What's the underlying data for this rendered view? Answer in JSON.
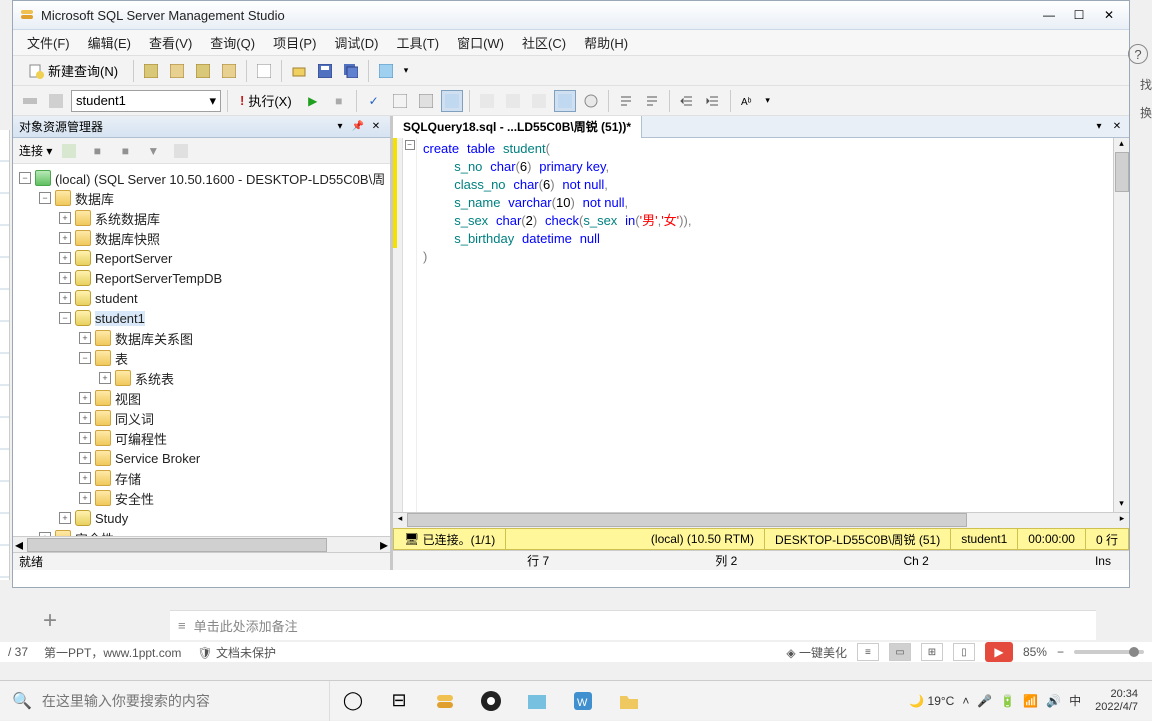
{
  "window": {
    "title": "Microsoft SQL Server Management Studio"
  },
  "menubar": [
    "文件(F)",
    "编辑(E)",
    "查看(V)",
    "查询(Q)",
    "项目(P)",
    "调试(D)",
    "工具(T)",
    "窗口(W)",
    "社区(C)",
    "帮助(H)"
  ],
  "toolbar1": {
    "newquery": "新建查询(N)"
  },
  "toolbar2": {
    "database": "student1",
    "execute": "执行(X)"
  },
  "objectExplorer": {
    "title": "对象资源管理器",
    "connect": "连接 ▾",
    "server": "(local) (SQL Server 10.50.1600 - DESKTOP-LD55C0B\\周",
    "nodes": {
      "databases": "数据库",
      "sysdb": "系统数据库",
      "snapshot": "数据库快照",
      "report": "ReportServer",
      "reportTemp": "ReportServerTempDB",
      "student": "student",
      "student1": "student1",
      "diagram": "数据库关系图",
      "tables": "表",
      "systables": "系统表",
      "views": "视图",
      "synonyms": "同义词",
      "programmability": "可编程性",
      "servicebroker": "Service Broker",
      "storage": "存储",
      "security1": "安全性",
      "study": "Study",
      "security2": "安全性"
    },
    "status": "就绪"
  },
  "editor": {
    "tab": "SQLQuery18.sql - ...LD55C0B\\周锐 (51))*",
    "code": {
      "l1_create": "create",
      "l1_table": "table",
      "l1_name": "student",
      "l1_p": "(",
      "l2_col": "s_no",
      "l2_type": "char",
      "l2_p": "(",
      "l2_n": "6",
      "l2_pc": ")",
      "l2_pk": "primary key",
      "l2_c": ",",
      "l3_col": "class_no",
      "l3_type": "char",
      "l3_p": "(",
      "l3_n": "6",
      "l3_pc": ")",
      "l3_nn": "not null",
      "l3_c": ",",
      "l4_col": "s_name",
      "l4_type": "varchar",
      "l4_p": "(",
      "l4_n": "10",
      "l4_pc": ")",
      "l4_nn": "not null",
      "l4_c": ",",
      "l5_col": "s_sex",
      "l5_type": "char",
      "l5_p": "(",
      "l5_n": "2",
      "l5_pc": ")",
      "l5_check": "check",
      "l5_po": "(",
      "l5_cid": "s_sex",
      "l5_in": "in",
      "l5_po2": "(",
      "l5_s1": "'男'",
      "l5_cm": ",",
      "l5_s2": "'女'",
      "l5_pc2": "))",
      "l5_c": ",",
      "l6_col": "s_birthday",
      "l6_type": "datetime",
      "l6_null": "null",
      "l7_p": ")"
    },
    "statusRow": {
      "row": "行 7",
      "col": "列 2",
      "ch": "Ch 2",
      "ins": "Ins"
    }
  },
  "connStatus": {
    "icon": "🖥",
    "connected": "已连接。(1/1)",
    "server": "(local) (10.50 RTM)",
    "login": "DESKTOP-LD55C0B\\周锐 (51)",
    "db": "student1",
    "time": "00:00:00",
    "rows": "0 行"
  },
  "ppt": {
    "slide": "/ 37",
    "template": "第一PPT，www.1ppt.com",
    "protect": "文档未保护",
    "notes": "单击此处添加备注",
    "beautify": "一键美化",
    "zoom": "85%"
  },
  "edge": {
    "find": "找",
    "replace": "换"
  },
  "taskbar": {
    "searchPlaceholder": "在这里输入你要搜索的内容",
    "weather": "19°C",
    "ime": "中",
    "time": "20:34",
    "date": "2022/4/7"
  }
}
